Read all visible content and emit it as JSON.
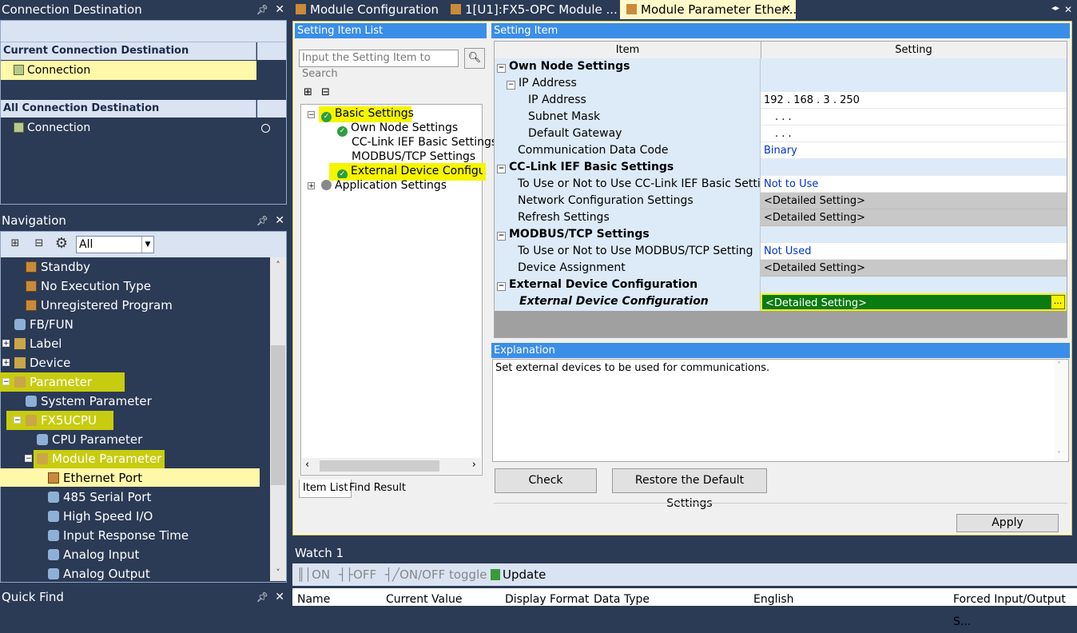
{
  "connection_panel": {
    "title": "Connection Destination",
    "current_header": "Current Connection Destination",
    "current_item": "Connection",
    "all_header": "All Connection Destination",
    "all_item": "Connection"
  },
  "navigation": {
    "title": "Navigation",
    "filter_value": "All",
    "items": [
      {
        "label": "Standby"
      },
      {
        "label": "No Execution Type"
      },
      {
        "label": "Unregistered Program"
      },
      {
        "label": "FB/FUN"
      },
      {
        "label": "Label"
      },
      {
        "label": "Device"
      },
      {
        "label": "Parameter"
      },
      {
        "label": "System Parameter"
      },
      {
        "label": "FX5UCPU"
      },
      {
        "label": "CPU Parameter"
      },
      {
        "label": "Module Parameter"
      },
      {
        "label": "Ethernet Port"
      },
      {
        "label": "485 Serial Port"
      },
      {
        "label": "High Speed I/O"
      },
      {
        "label": "Input Response Time"
      },
      {
        "label": "Analog Input"
      },
      {
        "label": "Analog Output"
      }
    ]
  },
  "quick_find": {
    "title": "Quick Find"
  },
  "doc_tabs": [
    {
      "label": "Module Configuration"
    },
    {
      "label": "1[U1]:FX5-OPC Module ..."
    },
    {
      "label": "Module Parameter Ether..."
    }
  ],
  "setting_item_list": {
    "title": "Setting Item List",
    "search_placeholder": "Input the Setting Item to Search",
    "tree": {
      "basic": "Basic Settings",
      "own_node": "Own Node Settings",
      "cclink": "CC-Link IEF Basic Settings",
      "modbus": "MODBUS/TCP Settings",
      "external": "External Device Configurati",
      "application": "Application Settings"
    },
    "tabs": {
      "item_list": "Item List",
      "find_result": "Find Result"
    }
  },
  "setting_item": {
    "title": "Setting Item",
    "col_item": "Item",
    "col_setting": "Setting",
    "rows": {
      "own_node": "Own Node Settings",
      "ip_address_group": "IP Address",
      "ip_address": "IP Address",
      "ip_address_value": "192 . 168 .   3 . 250",
      "subnet_mask": "Subnet Mask",
      "subnet_value": ".     .     .",
      "default_gateway": "Default Gateway",
      "gateway_value": ".     .     .",
      "comm_code": "Communication Data Code",
      "comm_code_value": "Binary",
      "cclink_header": "CC-Link IEF Basic Settings",
      "cclink_use": "To Use or Not to Use CC-Link IEF Basic Setting",
      "cclink_use_value": "Not to Use",
      "network_config": "Network Configuration Settings",
      "network_config_value": "<Detailed Setting>",
      "refresh": "Refresh Settings",
      "refresh_value": "<Detailed Setting>",
      "modbus_header": "MODBUS/TCP Settings",
      "modbus_use": "To Use or Not to Use MODBUS/TCP Setting",
      "modbus_use_value": "Not Used",
      "device_assign": "Device Assignment",
      "device_assign_value": "<Detailed Setting>",
      "ext_header": "External Device Configuration",
      "ext_item": "External Device Configuration",
      "ext_value": "<Detailed Setting>",
      "ext_button": "..."
    }
  },
  "explanation": {
    "title": "Explanation",
    "text": "Set external devices to be used for communications."
  },
  "buttons": {
    "check": "Check",
    "restore": "Restore the Default Settings",
    "apply": "Apply"
  },
  "watch": {
    "title": "Watch 1",
    "toolbar": {
      "on": "ON",
      "off": "OFF",
      "toggle": "ON/OFF toggle",
      "update": "Update"
    },
    "columns": [
      "Name",
      "Current Value",
      "Display Format",
      "Data Type",
      "English",
      "Forced Input/Output S..."
    ]
  },
  "colors": {
    "panel_bg": "#2b3a55",
    "highlight_yellow": "#f5f500",
    "selection_green": "#0a7a12",
    "title_blue": "#3b8ee8"
  }
}
